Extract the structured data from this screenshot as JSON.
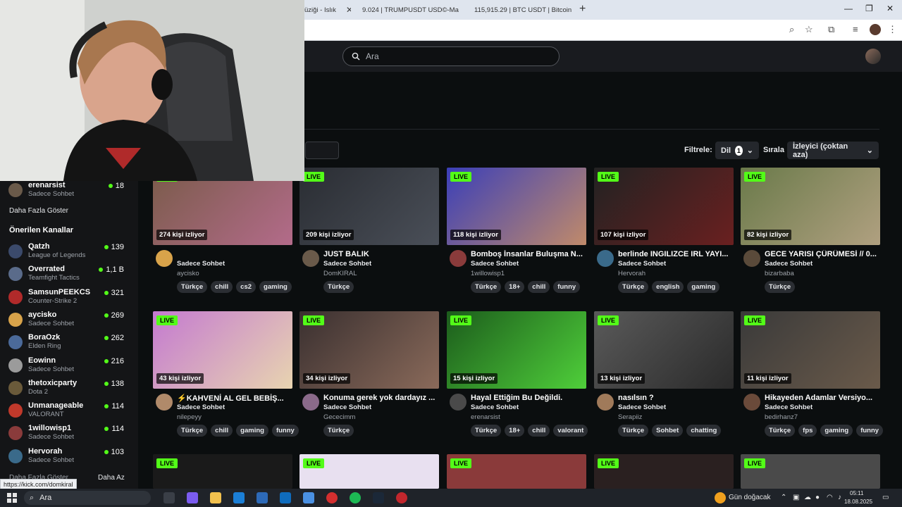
{
  "browser": {
    "tabs": [
      {
        "label": "üziği - Islık"
      },
      {
        "label": "9.024 | TRUMPUSDT USD©-Ma"
      },
      {
        "label": "115,915.29 | BTC USDT | Bitcoin"
      }
    ],
    "new_tab": "+",
    "status_url": "https://kick.com/domkiral"
  },
  "header": {
    "search_placeholder": "Ara"
  },
  "filters": {
    "filter_label": "Filtrele:",
    "language_label": "Dil",
    "language_count": "1",
    "sort_label": "Sırala",
    "sort_value": "İzleyici (çoktan aza)"
  },
  "sidebar": {
    "top_item": {
      "name": "erenarsist",
      "category": "Sadece Sohbet",
      "count": "18"
    },
    "show_more": "Daha Fazla Göster",
    "recommended_heading": "Önerilen Kanallar",
    "recommended": [
      {
        "name": "Qatzh",
        "category": "League of Legends",
        "count": "139"
      },
      {
        "name": "Overrated",
        "category": "Teamfight Tactics",
        "count": "1,1 B"
      },
      {
        "name": "SamsunPEEKCS",
        "category": "Counter-Strike 2",
        "count": "321"
      },
      {
        "name": "aycisko",
        "category": "Sadece Sohbet",
        "count": "269"
      },
      {
        "name": "BoraOzk",
        "category": "Elden Ring",
        "count": "262"
      },
      {
        "name": "Eowinn",
        "category": "Sadece Sohbet",
        "count": "216"
      },
      {
        "name": "thetoxicparty",
        "category": "Dota 2",
        "count": "138"
      },
      {
        "name": "Unmanageable",
        "category": "VALORANT",
        "count": "114"
      },
      {
        "name": "1willowisp1",
        "category": "Sadece Sohbet",
        "count": "114"
      },
      {
        "name": "Hervorah",
        "category": "Sadece Sohbet",
        "count": "103"
      }
    ],
    "show_more_bottom": "Daha Fazla Göster",
    "show_less": "Daha Az"
  },
  "live_label": "LIVE",
  "cards": [
    {
      "viewers": "274 kişi izliyor",
      "title": "",
      "category": "Sadece Sohbet",
      "user": "aycisko",
      "tags": [
        "Türkçe",
        "chill",
        "cs2",
        "gaming"
      ]
    },
    {
      "viewers": "209 kişi izliyor",
      "title": "JUST BALIK",
      "category": "Sadece Sohbet",
      "user": "DomKIRAL",
      "tags": [
        "Türkçe"
      ]
    },
    {
      "viewers": "118 kişi izliyor",
      "title": "Bomboş İnsanlar Buluşma N...",
      "category": "Sadece Sohbet",
      "user": "1willowisp1",
      "tags": [
        "Türkçe",
        "18+",
        "chill",
        "funny"
      ]
    },
    {
      "viewers": "107 kişi izliyor",
      "title": "berlinde INGILIZCE IRL YAYI...",
      "category": "Sadece Sohbet",
      "user": "Hervorah",
      "tags": [
        "Türkçe",
        "english",
        "gaming"
      ]
    },
    {
      "viewers": "82 kişi izliyor",
      "title": "GECE YARISI ÇÜRÜMESİ // 0...",
      "category": "Sadece Sohbet",
      "user": "bizarbaba",
      "tags": [
        "Türkçe"
      ]
    },
    {
      "viewers": "43 kişi izliyor",
      "title": "⚡KAHVENİ AL GEL BEBİŞ...",
      "category": "Sadece Sohbet",
      "user": "nilepeyy",
      "tags": [
        "Türkçe",
        "chill",
        "gaming",
        "funny"
      ]
    },
    {
      "viewers": "34 kişi izliyor",
      "title": "Konuma gerek yok dardayız ...",
      "category": "Sadece Sohbet",
      "user": "Gececimm",
      "tags": [
        "Türkçe"
      ]
    },
    {
      "viewers": "15 kişi izliyor",
      "title": "Hayal Ettiğim Bu Değildi.",
      "category": "Sadece Sohbet",
      "user": "erenarsist",
      "tags": [
        "Türkçe",
        "18+",
        "chill",
        "valorant"
      ]
    },
    {
      "viewers": "13 kişi izliyor",
      "title": "nasılsın ?",
      "category": "Sadece Sohbet",
      "user": "Serapiiz",
      "tags": [
        "Türkçe",
        "Sohbet",
        "chatting"
      ]
    },
    {
      "viewers": "11 kişi izliyor",
      "title": "Hikayeden Adamlar Versiyo...",
      "category": "Sadece Sohbet",
      "user": "bedirhanz7",
      "tags": [
        "Türkçe",
        "fps",
        "gaming",
        "funny"
      ]
    }
  ],
  "taskbar": {
    "search_label": "Ara",
    "weather": "Gün doğacak",
    "time": "05:11",
    "date": "18.08.2025"
  },
  "colors": {
    "accent": "#53fc18",
    "background": "#0b0e0f",
    "sidebar": "#141517"
  }
}
